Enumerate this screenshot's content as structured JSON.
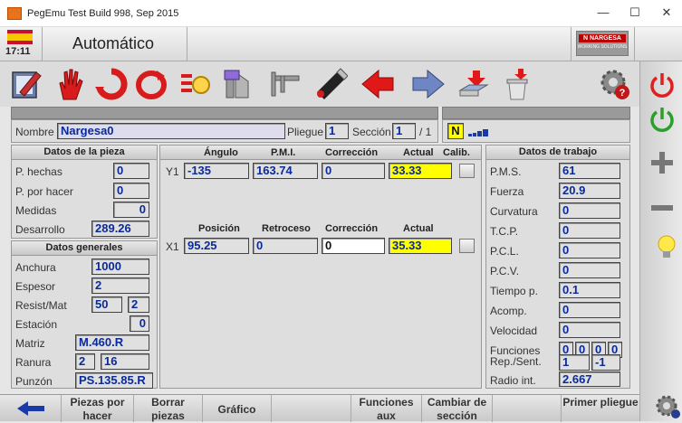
{
  "window": {
    "title": "PegEmu Test Build 998, Sep 2015",
    "minimize": "—",
    "maximize": "☐",
    "close": "✕"
  },
  "header": {
    "time": "17:11",
    "mode_title": "Automático",
    "brand_line1": "N NARGESA",
    "brand_line2": "WORKING SOLUTIONS"
  },
  "toolbar": {
    "icons": [
      "edit-program-icon",
      "hand-stop-icon",
      "cycle-icon",
      "cycle-outline-icon",
      "machine-settings-icon",
      "tools-icon",
      "caliper-icon",
      "usb-drive-icon",
      "arrow-left-icon",
      "arrow-right-icon",
      "save-icon",
      "trash-icon",
      "gear-help-icon"
    ]
  },
  "program": {
    "nombre_label": "Nombre",
    "nombre_value": "Nargesa0",
    "pliegue_label": "Pliegue",
    "pliegue_value": "1",
    "seccion_label": "Sección",
    "seccion_value": "1",
    "seccion_total": "/ 1",
    "mode_badge": "N"
  },
  "datos_pieza": {
    "title": "Datos de la pieza",
    "rows": [
      {
        "label": "P. hechas",
        "value": "0"
      },
      {
        "label": "P. por hacer",
        "value": "0"
      },
      {
        "label": "Medidas",
        "value": "0"
      },
      {
        "label": "Desarrollo",
        "value": "289.26"
      }
    ]
  },
  "datos_generales": {
    "title": "Datos generales",
    "anchura": {
      "label": "Anchura",
      "value": "1000"
    },
    "espesor": {
      "label": "Espesor",
      "value": "2"
    },
    "resist": {
      "label": "Resist/Mat",
      "value1": "50",
      "value2": "2"
    },
    "estacion": {
      "label": "Estación",
      "value": "0"
    },
    "matriz": {
      "label": "Matriz",
      "value": "M.460.R"
    },
    "ranura": {
      "label": "Ranura",
      "value1": "2",
      "value2": "16"
    },
    "punzon": {
      "label": "Punzón",
      "value": "PS.135.85.R"
    }
  },
  "axis_y": {
    "h_angulo": "Ángulo",
    "h_pmi": "P.M.I.",
    "h_correccion": "Corrección",
    "h_actual": "Actual",
    "h_calib": "Calib.",
    "label": "Y1",
    "angulo": "-135",
    "pmi": "163.74",
    "correccion": "0",
    "actual": "33.33"
  },
  "axis_x": {
    "h_posicion": "Posición",
    "h_retroceso": "Retroceso",
    "h_correccion": "Corrección",
    "h_actual": "Actual",
    "label": "X1",
    "posicion": "95.25",
    "retroceso": "0",
    "correccion": "0",
    "actual": "35.33"
  },
  "datos_trabajo": {
    "title": "Datos de trabajo",
    "rows": [
      {
        "label": "P.M.S.",
        "value": "61"
      },
      {
        "label": "Fuerza",
        "value": "20.9"
      },
      {
        "label": "Curvatura",
        "value": "0"
      },
      {
        "label": "T.C.P.",
        "value": "0"
      },
      {
        "label": "P.C.L.",
        "value": "0"
      },
      {
        "label": "P.C.V.",
        "value": "0"
      },
      {
        "label": "Tiempo p.",
        "value": "0.1"
      },
      {
        "label": "Acomp.",
        "value": "0"
      },
      {
        "label": "Velocidad",
        "value": "0"
      }
    ],
    "funciones": {
      "label": "Funciones",
      "values": [
        "0",
        "0",
        "0",
        "0"
      ]
    },
    "rep": {
      "label": "Rep./Sent.",
      "value1": "1",
      "value2": "-1"
    },
    "radio": {
      "label": "Radio int.",
      "value": "2.667"
    }
  },
  "bottom": {
    "piezas": "Piezas por hacer",
    "borrar": "Borrar piezas",
    "grafico": "Gráfico",
    "funciones_aux": "Funciones aux",
    "cambiar": "Cambiar de sección",
    "primer": "Primer pliegue"
  },
  "colors": {
    "value_text": "#0a2a9a",
    "highlight": "#ffff00",
    "stop_red": "#e02020",
    "start_green": "#2aa02a"
  }
}
